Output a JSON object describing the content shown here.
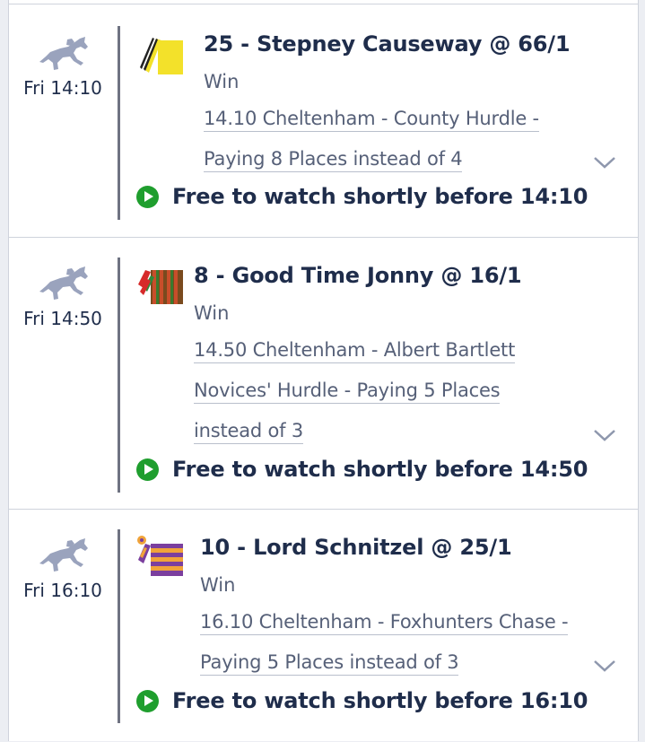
{
  "colors": {
    "accent_green": "#1f9e2e",
    "text_dark": "#1f2d4b",
    "text_muted": "#566078",
    "divider": "#cfd3dc"
  },
  "icons": {
    "horse": "horse-racing-icon",
    "play": "play-circle-icon",
    "expand": "chevron-down-icon"
  },
  "bets": [
    {
      "time": "Fri 14:10",
      "selection": "25 - Stepney Causeway @ 66/1",
      "market": "Win",
      "description_lines": [
        "14.10 Cheltenham - County Hurdle -",
        "Paying 8 Places instead of 4"
      ],
      "watch": "Free to watch shortly before 14:10",
      "silk": "yellow-black-sash"
    },
    {
      "time": "Fri 14:50",
      "selection": "8 - Good Time Jonny @ 16/1",
      "market": "Win",
      "description_lines": [
        "14.50 Cheltenham - Albert Bartlett",
        "Novices' Hurdle - Paying 5 Places",
        "instead of 3"
      ],
      "watch": "Free to watch shortly before 14:50",
      "silk": "red-green-stripes"
    },
    {
      "time": "Fri 16:10",
      "selection": "10 - Lord Schnitzel @ 25/1",
      "market": "Win",
      "description_lines": [
        "16.10 Cheltenham - Foxhunters Chase -",
        "Paying 5 Places instead of 3"
      ],
      "watch": "Free to watch shortly before 16:10",
      "silk": "purple-orange-hoops"
    }
  ]
}
